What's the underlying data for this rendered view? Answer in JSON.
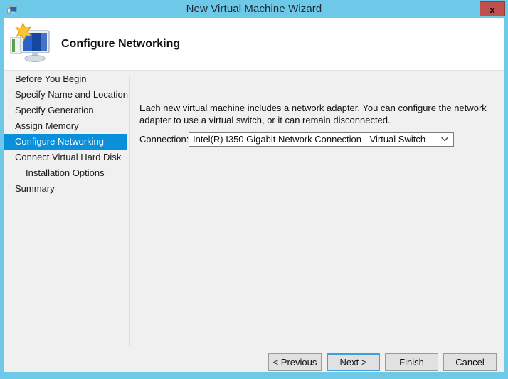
{
  "window": {
    "title": "New Virtual Machine Wizard",
    "title_icon": "virtual-machine-icon",
    "close_label": "x",
    "frame_color": "#6ec9e8",
    "body_color": "#f0f0f0"
  },
  "header": {
    "title": "Configure Networking",
    "icon": "monitor-star-icon"
  },
  "sidebar": {
    "selected_color": "#0a8fdb",
    "items": [
      {
        "label": "Before You Begin",
        "selected": false,
        "sub": false
      },
      {
        "label": "Specify Name and Location",
        "selected": false,
        "sub": false
      },
      {
        "label": "Specify Generation",
        "selected": false,
        "sub": false
      },
      {
        "label": "Assign Memory",
        "selected": false,
        "sub": false
      },
      {
        "label": "Configure Networking",
        "selected": true,
        "sub": false
      },
      {
        "label": "Connect Virtual Hard Disk",
        "selected": false,
        "sub": false
      },
      {
        "label": "Installation Options",
        "selected": false,
        "sub": true
      },
      {
        "label": "Summary",
        "selected": false,
        "sub": false
      }
    ]
  },
  "content": {
    "intro_text": "Each new virtual machine includes a network adapter. You can configure the network adapter to use a virtual switch, or it can remain disconnected.",
    "connection_label": "Connection:",
    "connection_value": "Intel(R) I350 Gigabit Network Connection - Virtual Switch",
    "connection_options": [
      "Intel(R) I350 Gigabit Network Connection - Virtual Switch"
    ]
  },
  "footer": {
    "previous_label": "< Previous",
    "next_label": "Next >",
    "finish_label": "Finish",
    "cancel_label": "Cancel",
    "default_button": "Next >",
    "focus_color": "#3ea1dd"
  }
}
